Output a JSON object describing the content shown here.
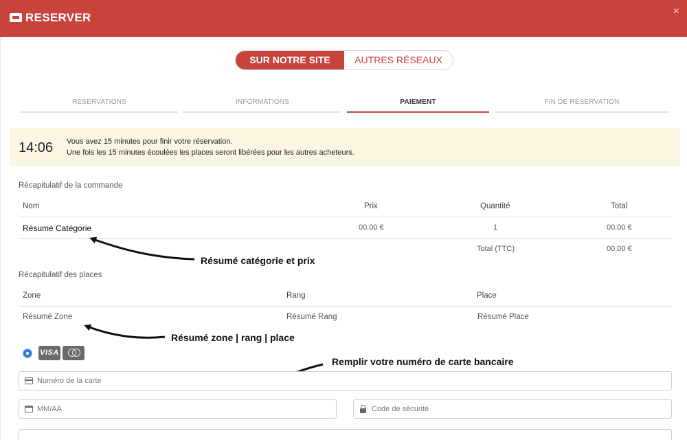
{
  "header": {
    "title": "RESERVER",
    "close": "×"
  },
  "toggle": {
    "active": "SUR NOTRE SITE",
    "inactive": "AUTRES RÉSEAUX"
  },
  "steps": [
    "RÉSERVATIONS",
    "INFORMATIONS",
    "PAIEMENT",
    "FIN DE RÉSERVATION"
  ],
  "active_step": "PAIEMENT",
  "timer": {
    "time": "14:06",
    "line1": "Vous avez 15 minutes pour finir votre réservation.",
    "line2": "Une fois les 15 minutes écoulées les places seront libérées pour les autres acheteurs."
  },
  "order_summary": {
    "title": "Récapitulatif de la commande",
    "columns": [
      "Nom",
      "Prix",
      "Quantité",
      "Total"
    ],
    "row": {
      "name": "Résumé Catégorie",
      "price": "00.00 €",
      "quantity": "1",
      "total": "00.00 €"
    },
    "total_label": "Total (TTC)",
    "total_value": "00.00 €"
  },
  "seats_summary": {
    "title": "Récapitulatif des places",
    "columns": [
      "Zone",
      "Rang",
      "Place"
    ],
    "row": {
      "zone": "Résumé Zone",
      "rang": "Résumé Rang",
      "place": "Résumé Place"
    }
  },
  "annotations": {
    "category": "Résumé catégorie et prix",
    "zone": "Résumé zone | rang | place",
    "card": "Remplir votre numéro de carte bancaire"
  },
  "payment": {
    "visa_label": "VISA",
    "card_number_placeholder": "Numéro de la carte",
    "expiry_placeholder": "MM/AA",
    "security_placeholder": "Code de sécurité"
  },
  "icons": {
    "header": "ticket-icon",
    "close": "close-icon",
    "card": "credit-card-icon",
    "expiry": "calendar-icon",
    "security": "lock-icon",
    "mastercard": "mastercard-icon"
  },
  "colors": {
    "brand": "#c9433d",
    "timer_bg": "#faf6e1",
    "radio": "#2f7bd9"
  }
}
